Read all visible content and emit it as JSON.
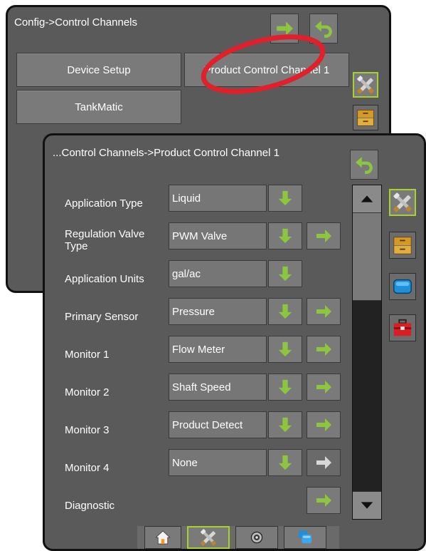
{
  "back_panel": {
    "title": "Config->Control Channels",
    "buttons": [
      {
        "label": "Device Setup"
      },
      {
        "label": "Product Control Channel 1"
      },
      {
        "label": "TankMatic"
      }
    ]
  },
  "front_panel": {
    "title": "...Control Channels->Product Control Channel 1",
    "rows": [
      {
        "label": "Application Type",
        "value": "Liquid"
      },
      {
        "label": "Regulation Valve Type",
        "value": "PWM Valve"
      },
      {
        "label": "Application Units",
        "value": "gal/ac"
      },
      {
        "label": "Primary Sensor",
        "value": "Pressure"
      },
      {
        "label": "Monitor 1",
        "value": "Flow Meter"
      },
      {
        "label": "Monitor 2",
        "value": "Shaft Speed"
      },
      {
        "label": "Monitor 3",
        "value": "Product Detect"
      },
      {
        "label": "Monitor 4",
        "value": "None"
      },
      {
        "label": "Diagnostic",
        "value": ""
      }
    ]
  },
  "colors": {
    "panel": "#5a5a5a",
    "accent_green": "#8cc63f",
    "highlight": "#a6d22b",
    "annotation_red": "#e0202a"
  },
  "icons": {
    "next": "arrow-right-icon",
    "back": "back-arrow-icon",
    "dropdown": "arrow-down-icon",
    "tools": "tools-icon",
    "drawer": "drawer-icon",
    "display": "screen-icon",
    "toolbox": "toolbox-icon",
    "home": "home-icon",
    "gps": "gps-icon",
    "data": "data-icon",
    "scroll_up": "triangle-up-icon",
    "scroll_down": "triangle-down-icon"
  }
}
